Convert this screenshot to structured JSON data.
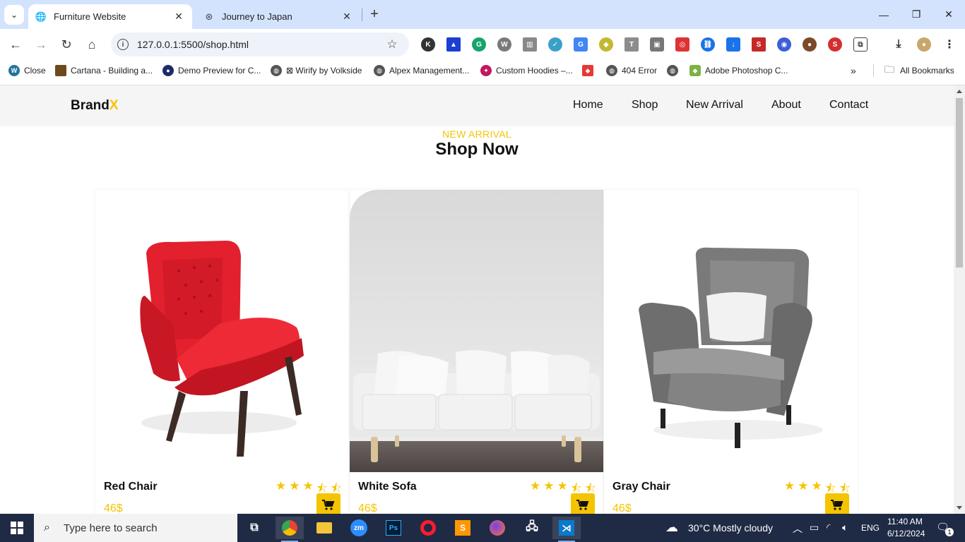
{
  "browser": {
    "tabs": [
      {
        "title": "Furniture Website",
        "active": true
      },
      {
        "title": "Journey to Japan",
        "active": false
      }
    ],
    "url": "127.0.0.1:5500/shop.html",
    "bookmarks": [
      "Close",
      "Cartana - Building a...",
      "Demo Preview for C...",
      "⊠ Wirify by Volkside",
      "Alpex Management...",
      "Custom Hoodies –...",
      "404 Error",
      "Adobe Photoshop C..."
    ],
    "all_bookmarks_label": "All Bookmarks"
  },
  "site": {
    "logo_main": "Brand",
    "logo_accent": "X",
    "nav": [
      "Home",
      "Shop",
      "New Arrival",
      "About",
      "Contact"
    ],
    "section_subtitle": "NEW ARRIVAL",
    "section_title": "Shop Now",
    "products": [
      {
        "name": "Red Chair",
        "price": "46$",
        "rating": 4.5
      },
      {
        "name": "White Sofa",
        "price": "46$",
        "rating": 4.5
      },
      {
        "name": "Gray Chair",
        "price": "46$",
        "rating": 4.5
      }
    ],
    "accent_color": "#f5c400"
  },
  "taskbar": {
    "search_placeholder": "Type here to search",
    "weather": "30°C  Mostly cloudy",
    "language": "ENG",
    "time": "11:40 AM",
    "date": "6/12/2024",
    "notification_count": "1"
  }
}
